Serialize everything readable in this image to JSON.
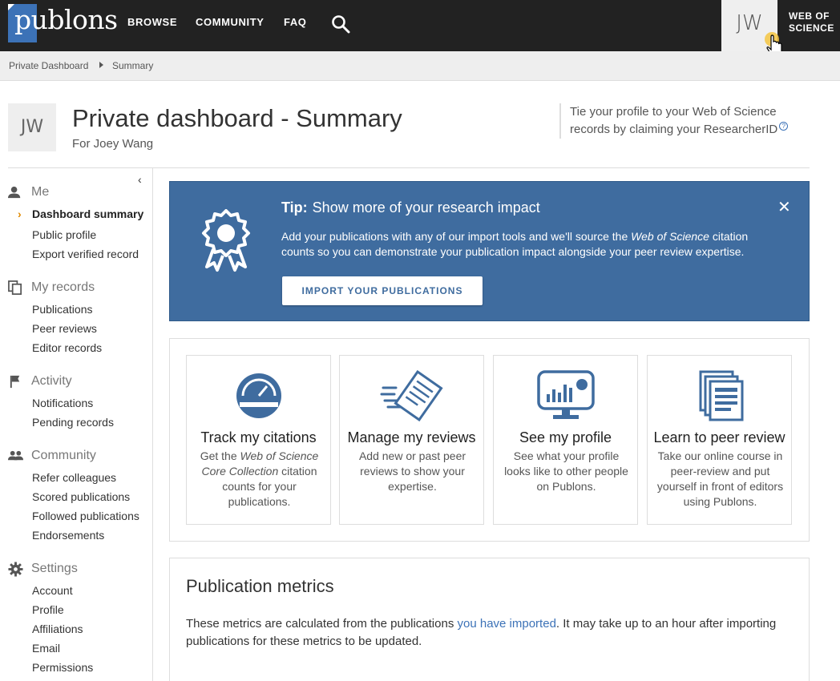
{
  "nav": {
    "logo": "publons",
    "items": [
      "BROWSE",
      "COMMUNITY",
      "FAQ"
    ],
    "avatar_initials": "JW",
    "wos_line1": "WEB OF",
    "wos_line2": "SCIENCE"
  },
  "breadcrumb": {
    "items": [
      "Private Dashboard",
      "Summary"
    ]
  },
  "header": {
    "avatar_initials": "JW",
    "title": "Private dashboard - Summary",
    "subtitle": "For Joey Wang",
    "claim_line1": "Tie your profile to your Web of Science",
    "claim_line2": "records by claiming your ResearcherID"
  },
  "sidebar": {
    "sections": [
      {
        "label": "Me",
        "icon": "person-icon",
        "items": [
          "Dashboard summary",
          "Public profile",
          "Export verified record"
        ]
      },
      {
        "label": "My records",
        "icon": "copy-icon",
        "items": [
          "Publications",
          "Peer reviews",
          "Editor records"
        ]
      },
      {
        "label": "Activity",
        "icon": "flag-icon",
        "items": [
          "Notifications",
          "Pending records"
        ]
      },
      {
        "label": "Community",
        "icon": "people-icon",
        "items": [
          "Refer colleagues",
          "Scored publications",
          "Followed publications",
          "Endorsements"
        ]
      },
      {
        "label": "Settings",
        "icon": "gear-icon",
        "items": [
          "Account",
          "Profile",
          "Affiliations",
          "Email",
          "Permissions"
        ]
      }
    ],
    "active": "Dashboard summary"
  },
  "tip": {
    "prefix": "Tip:",
    "title": "Show more of your research impact",
    "body_before": "Add your publications with any of our import tools and we'll source the ",
    "body_em": "Web of Science",
    "body_after": " citation counts so you can demonstrate your publication impact alongside your peer review expertise.",
    "button": "IMPORT YOUR PUBLICATIONS"
  },
  "cards": [
    {
      "title": "Track my citations",
      "icon": "gauge-icon",
      "desc_before": "Get the ",
      "desc_em": "Web of Science Core Collection",
      "desc_after": " citation counts for your publications."
    },
    {
      "title": "Manage my reviews",
      "icon": "review-document-icon",
      "desc_before": "Add new or past peer reviews to show your expertise.",
      "desc_em": "",
      "desc_after": ""
    },
    {
      "title": "See my profile",
      "icon": "monitor-chart-icon",
      "desc_before": "See what your profile looks like to other people on Publons.",
      "desc_em": "",
      "desc_after": ""
    },
    {
      "title": "Learn to peer review",
      "icon": "document-stack-icon",
      "desc_before": "Take our online course in peer-review and put yourself in front of editors using Publons.",
      "desc_em": "",
      "desc_after": ""
    }
  ],
  "metrics": {
    "title": "Publication metrics",
    "body_before": "These metrics are calculated from the publications ",
    "link": "you have imported",
    "body_after": ".  It may take up to an hour after importing publications for these metrics to be updated."
  },
  "colors": {
    "topbar": "#222222",
    "accent": "#3f6c9f",
    "logo_blue": "#3c72b7",
    "active_chevron": "#e08a00"
  }
}
